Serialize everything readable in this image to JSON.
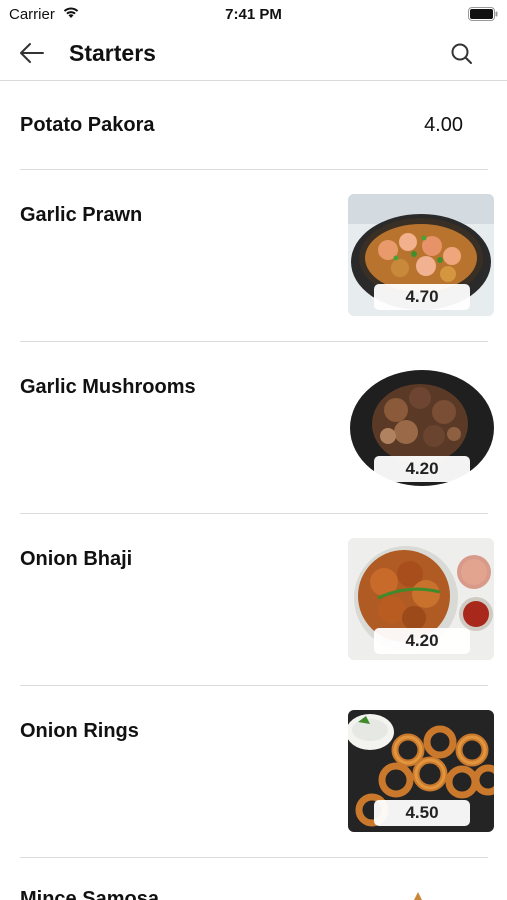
{
  "status_bar": {
    "carrier": "Carrier",
    "time": "7:41 PM"
  },
  "nav": {
    "title": "Starters",
    "back_icon": "arrow-left-icon",
    "search_icon": "search-icon"
  },
  "items": [
    {
      "name": "Potato Pakora",
      "price": "4.00"
    },
    {
      "name": "Garlic Prawn",
      "price": "4.70"
    },
    {
      "name": "Garlic Mushrooms",
      "price": "4.20"
    },
    {
      "name": "Onion Bhaji",
      "price": "4.20"
    },
    {
      "name": "Onion Rings",
      "price": "4.50"
    },
    {
      "name": "Mince Samosa"
    }
  ]
}
